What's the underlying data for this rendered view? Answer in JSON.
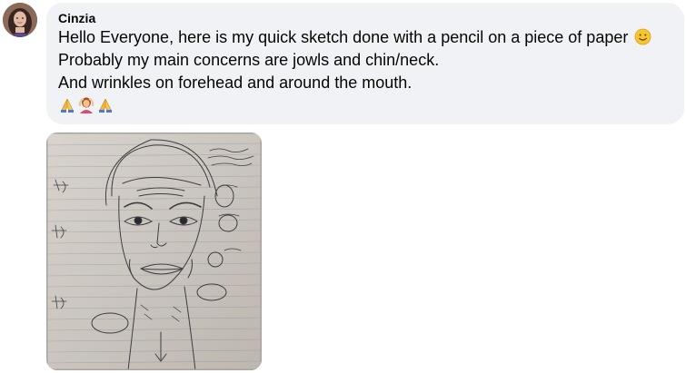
{
  "comment": {
    "author": "Cinzia",
    "lines": [
      "Hello Everyone, here is my quick sketch done with a pencil on a piece of paper",
      "Probably my main concerns are jowls and chin/neck.",
      "And wrinkles on forehead and around the mouth."
    ],
    "inline_emoji": "slightly-smiling-face",
    "emoji_row": [
      "folded-hands",
      "person-gesturing-ok",
      "folded-hands"
    ]
  },
  "attachment": {
    "type": "photo",
    "description_icon": "pencil-sketch-photo"
  },
  "colors": {
    "bubble": "#f0f2f5",
    "text": "#050505",
    "paper": "#cfcac4",
    "ruled_line": "#8a8e9c"
  }
}
